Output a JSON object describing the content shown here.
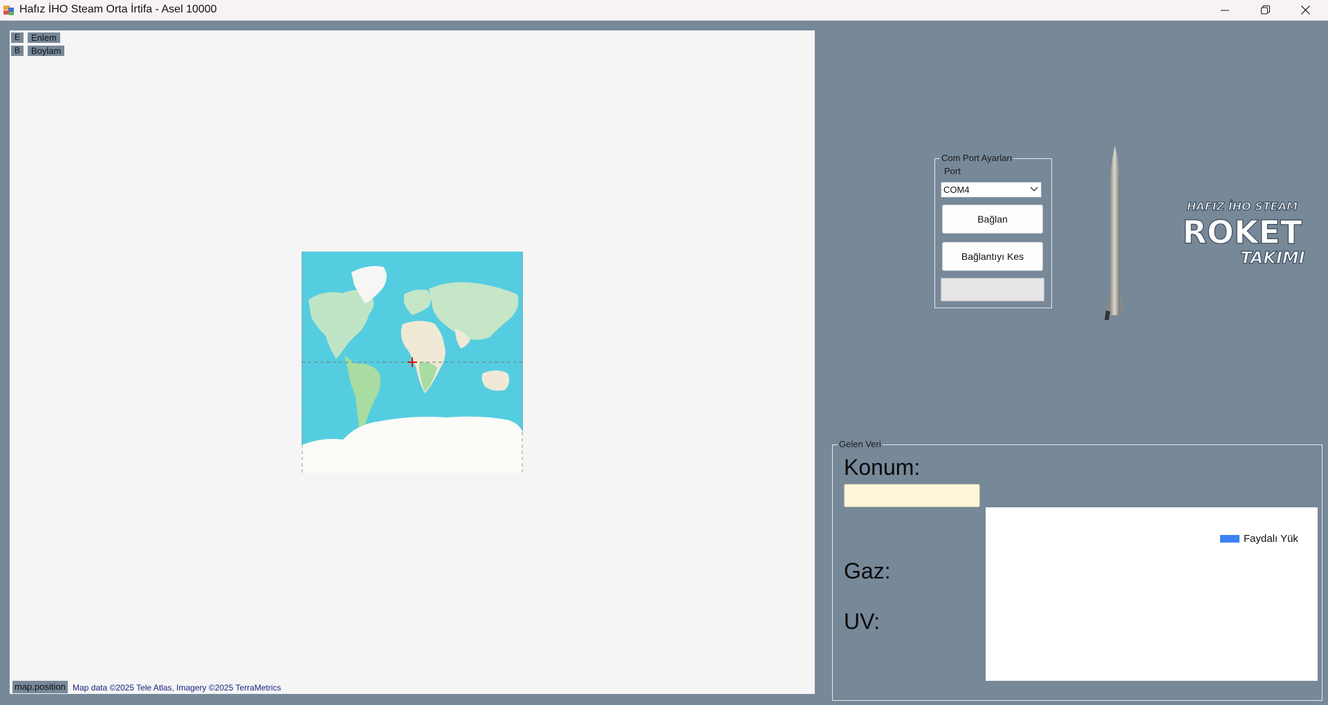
{
  "window": {
    "title": "Hafız İHO Steam Orta İrtifa - Asel 10000",
    "controls": [
      "minimize-icon",
      "restore-icon",
      "close-icon"
    ]
  },
  "map": {
    "coords": [
      {
        "key": "E",
        "label": "Enlem"
      },
      {
        "key": "B",
        "label": "Boylam"
      }
    ],
    "position_label": "map.position",
    "attribution": "Map data ©2025 Tele Atlas, Imagery ©2025 TerraMetrics",
    "center_marker_icon": "crosshair-icon"
  },
  "com_port": {
    "group_title": "Com Port Ayarları",
    "port_label": "Port",
    "port_value": "COM4",
    "connect_label": "Bağlan",
    "disconnect_label": "Bağlantıyı Kes",
    "progress": 0
  },
  "logo": {
    "line1": "HAFIZ İHO STEAM",
    "line2": "ROKET",
    "line3": "TAKIMI"
  },
  "incoming": {
    "group_title": "Gelen Veri",
    "konum_label": "Konum:",
    "konum_value": "",
    "gaz_label": "Gaz:",
    "uv_label": "UV:"
  },
  "chart_data": {
    "type": "line",
    "series": [
      {
        "name": "Faydalı Yük",
        "values": []
      }
    ],
    "legend_position": "top-right"
  },
  "colors": {
    "background": "#778899",
    "map_ocean": "#55cde0",
    "series_color": "#3c82f5",
    "konum_field": "#fdf6d8"
  }
}
